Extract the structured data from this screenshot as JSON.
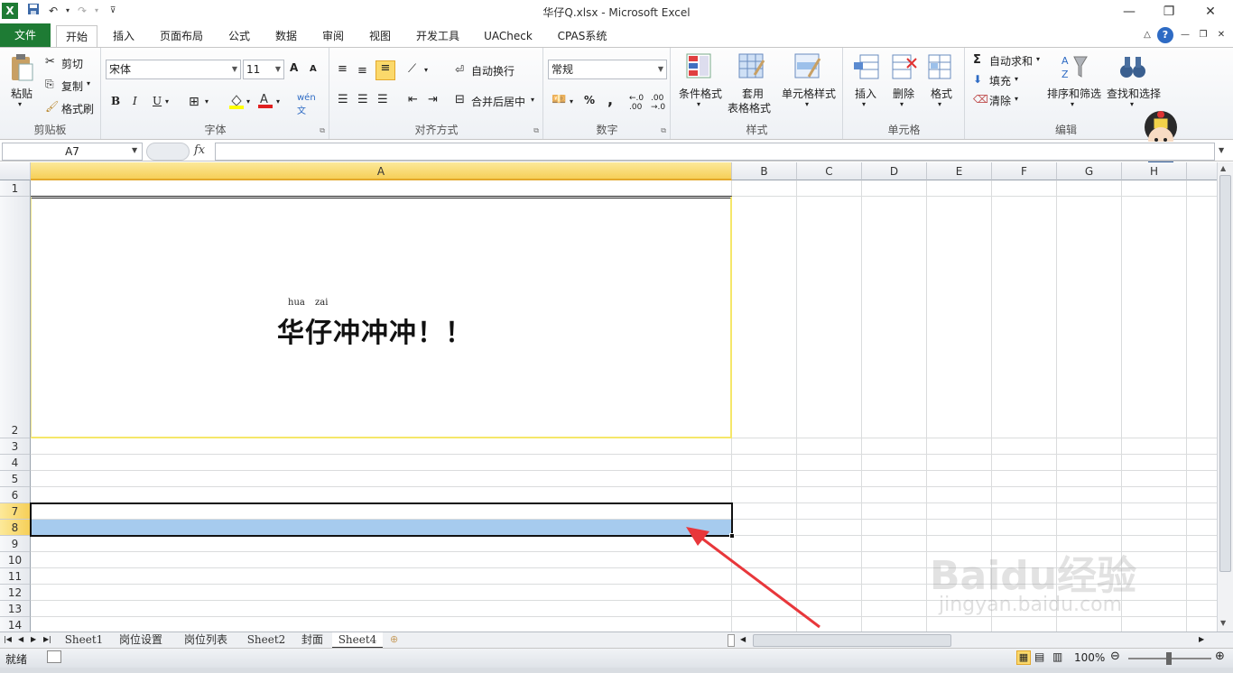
{
  "window": {
    "title": "华仔Q.xlsx  -  Microsoft Excel"
  },
  "quick_access": {
    "save": "save-icon",
    "undo": "undo-icon",
    "redo": "redo-icon"
  },
  "tabs": [
    {
      "label": "文件"
    },
    {
      "label": "开始"
    },
    {
      "label": "插入"
    },
    {
      "label": "页面布局"
    },
    {
      "label": "公式"
    },
    {
      "label": "数据"
    },
    {
      "label": "审阅"
    },
    {
      "label": "视图"
    },
    {
      "label": "开发工具"
    },
    {
      "label": "UACheck"
    },
    {
      "label": "CPAS系统"
    }
  ],
  "ribbon": {
    "clipboard": {
      "paste": "粘贴",
      "cut": "剪切",
      "copy": "复制",
      "format_painter": "格式刷",
      "group": "剪贴板"
    },
    "font": {
      "name": "宋体",
      "size": "11",
      "bold": "B",
      "italic": "I",
      "underline": "U",
      "grow": "A",
      "shrink": "A",
      "group": "字体"
    },
    "alignment": {
      "wrap": "自动换行",
      "merge": "合并后居中",
      "group": "对齐方式"
    },
    "number": {
      "format": "常规",
      "percent": "%",
      "comma": ",",
      "group": "数字"
    },
    "styles": {
      "conditional": "条件格式",
      "table_1": "套用",
      "table_2": "表格格式",
      "cell_styles": "单元格样式",
      "group": "样式"
    },
    "cells": {
      "insert": "插入",
      "delete": "删除",
      "format": "格式",
      "group": "单元格"
    },
    "editing": {
      "autosum": "自动求和",
      "fill": "填充",
      "clear": "清除",
      "sort": "排序和筛选",
      "find": "查找和选择",
      "group": "编辑"
    }
  },
  "formula_bar": {
    "name_box": "A7",
    "fx": "fx",
    "value": ""
  },
  "grid": {
    "columns": [
      "A",
      "B",
      "C",
      "D",
      "E",
      "F",
      "G",
      "H"
    ],
    "rows": [
      "1",
      "2",
      "3",
      "4",
      "5",
      "6",
      "7",
      "8",
      "9",
      "10",
      "11",
      "12",
      "13",
      "14"
    ],
    "selected_column": "A",
    "selected_rows": [
      "7",
      "8"
    ],
    "cell_A2": {
      "text": "华仔冲冲冲！！",
      "pinyin_hua": "hua",
      "pinyin_zai": "zai"
    }
  },
  "sheets": [
    "Sheet1",
    "岗位设置",
    "岗位列表",
    "Sheet2",
    "封面",
    "Sheet4"
  ],
  "active_sheet": "Sheet4",
  "status": {
    "ready": "就绪",
    "zoom": "100%"
  },
  "watermark": {
    "brand": "Baidu经验",
    "url": "jingyan.baidu.com"
  },
  "colors": {
    "accent": "#1e7b34",
    "selection_fill": "#a6cbee",
    "header_sel": "#f6cf58",
    "arrow": "#e8373b"
  }
}
